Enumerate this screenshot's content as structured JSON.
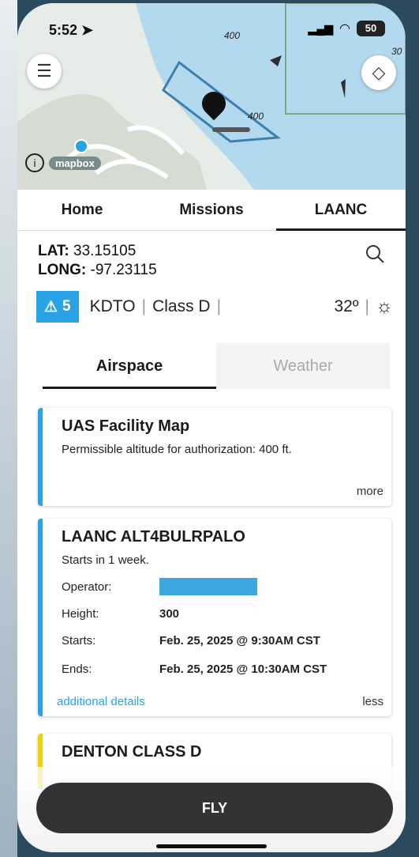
{
  "status": {
    "time": "5:52",
    "battery": "50"
  },
  "map": {
    "labels": [
      "400",
      "400",
      "30"
    ],
    "attribution": "mapbox"
  },
  "tabs": [
    {
      "label": "Home"
    },
    {
      "label": "Missions"
    },
    {
      "label": "LAANC"
    }
  ],
  "location": {
    "lat_label": "LAT:",
    "lat_value": "33.15105",
    "long_label": "LONG:",
    "long_value": "-97.23115"
  },
  "info": {
    "alert_count": "5",
    "airport": "KDTO",
    "airspace_class": "Class D",
    "temperature": "32º"
  },
  "subtabs": [
    {
      "label": "Airspace"
    },
    {
      "label": "Weather"
    }
  ],
  "cards": {
    "facility": {
      "title": "UAS Facility Map",
      "text": "Permissible altitude for authorization: 400 ft.",
      "more": "more"
    },
    "laanc": {
      "title": "LAANC ALT4BULRPALO",
      "subtitle": "Starts in 1 week.",
      "rows": [
        {
          "key": "Operator:",
          "value": ""
        },
        {
          "key": "Height:",
          "value": "300"
        },
        {
          "key": "Starts:",
          "value": "Feb. 25, 2025 @ 9:30AM CST"
        },
        {
          "key": "Ends:",
          "value": "Feb. 25, 2025 @ 10:30AM CST"
        }
      ],
      "additional": "additional details",
      "less": "less"
    },
    "denton": {
      "title": "DENTON CLASS D"
    }
  },
  "fly_button": "FLY",
  "colors": {
    "accent": "#29a3e6",
    "warning": "#f0d000",
    "airspace": "#a7d4ef"
  }
}
